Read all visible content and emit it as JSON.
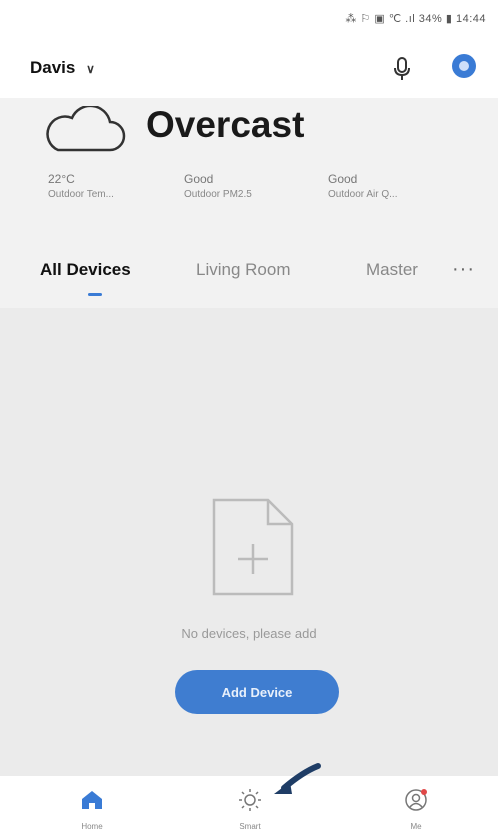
{
  "status_bar": {
    "text": "⁂ ⚐ ▣ ℃ .ıl 34% ▮ 14:44"
  },
  "header": {
    "home_name": "Davis",
    "chevron": "∨"
  },
  "weather": {
    "condition": "Overcast",
    "stats": [
      {
        "value": "22°C",
        "label": "Outdoor Tem..."
      },
      {
        "value": "Good",
        "label": "Outdoor PM2.5"
      },
      {
        "value": "Good",
        "label": "Outdoor Air Q..."
      }
    ]
  },
  "tabs": {
    "items": [
      "All Devices",
      "Living Room",
      "Master"
    ],
    "active_index": 0,
    "more": "···"
  },
  "empty_state": {
    "message": "No devices, please add",
    "button_label": "Add Device"
  },
  "bottom_nav": [
    {
      "label": "Home",
      "icon": "home-icon"
    },
    {
      "label": "Smart",
      "icon": "sun-icon"
    },
    {
      "label": "Me",
      "icon": "user-icon"
    }
  ],
  "colors": {
    "accent": "#3a7bd5",
    "background": "#f2f2f2"
  }
}
